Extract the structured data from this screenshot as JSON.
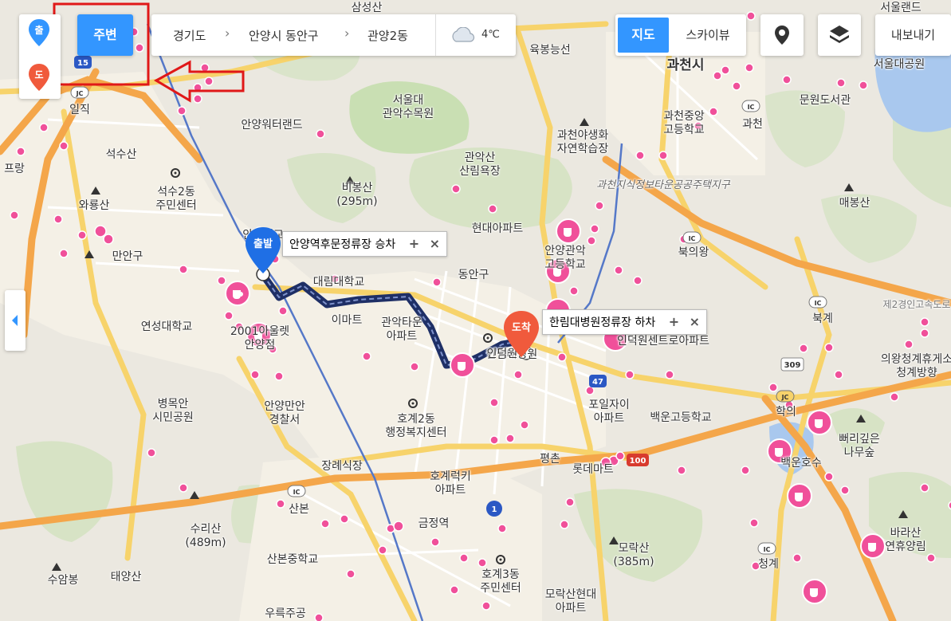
{
  "side_markers": {
    "start": "출",
    "end": "도"
  },
  "nearby_button": "주변",
  "breadcrumb": [
    "경기도",
    "안양시 동안구",
    "관양2동"
  ],
  "weather": "4℃",
  "map_type": {
    "map": "지도",
    "sky": "스카이뷰"
  },
  "export_button": "내보내기",
  "route": {
    "start_badge": "출발",
    "start_label": "안양역후문정류장 승차",
    "end_badge": "도착",
    "end_label": "한림대병원정류장 하차"
  },
  "road_badges": {
    "r15": "15",
    "r47": "47",
    "r100": "100",
    "r309": "309",
    "r1": "1",
    "jc": "JC",
    "ic": "IC"
  },
  "place_labels": [
    {
      "t": "삼성산"
    },
    {
      "t": "육봉능선"
    },
    {
      "t": "서울랜드"
    },
    {
      "t": "과천시"
    },
    {
      "t": "서울대공원"
    },
    {
      "t": "일직"
    },
    {
      "t": "서울대\n관악수목원"
    },
    {
      "t": "안양워터랜드"
    },
    {
      "t": "과천중앙\n고등학교"
    },
    {
      "t": "과천"
    },
    {
      "t": "문원도서관"
    },
    {
      "t": "과천야생화\n자연학습장"
    },
    {
      "t": "석수산"
    },
    {
      "t": "관악산\n산림욕장"
    },
    {
      "t": "과천지식정보타운공공주택지구"
    },
    {
      "t": "석수2동\n주민센터"
    },
    {
      "t": "비봉산\n(295m)"
    },
    {
      "t": "매봉산"
    },
    {
      "t": "와룡산"
    },
    {
      "t": "현대아파트"
    },
    {
      "t": "만안구"
    },
    {
      "t": "북의왕"
    },
    {
      "t": "안양대교"
    },
    {
      "t": "안양관악\n고등학교"
    },
    {
      "t": "대림대학교"
    },
    {
      "t": "동안구"
    },
    {
      "t": "제2경인고속도로"
    },
    {
      "t": "연성대학교"
    },
    {
      "t": "이마트"
    },
    {
      "t": "관악타운\n아파트"
    },
    {
      "t": "2001아울렛\n안양점"
    },
    {
      "t": "한림대병원"
    },
    {
      "t": "인덕원센트로아파트"
    },
    {
      "t": "북계"
    },
    {
      "t": "의왕청계휴게소\n청계방향"
    },
    {
      "t": "병목안\n시민공원"
    },
    {
      "t": "포일자이\n아파트"
    },
    {
      "t": "안양만안\n경찰서"
    },
    {
      "t": "호계2동\n행정복지센터"
    },
    {
      "t": "백운고등학교"
    },
    {
      "t": "학의"
    },
    {
      "t": "뻐리깊은\n나무숲"
    },
    {
      "t": "장례식장"
    },
    {
      "t": "평촌"
    },
    {
      "t": "롯데마트"
    },
    {
      "t": "백운호수"
    },
    {
      "t": "호계럭키\n아파트"
    },
    {
      "t": "산본"
    },
    {
      "t": "수리산\n(489m)"
    },
    {
      "t": "금정역"
    },
    {
      "t": "모락산\n(385m)"
    },
    {
      "t": "바라산\n연휴양림"
    },
    {
      "t": "산본중학교"
    },
    {
      "t": "청계"
    },
    {
      "t": "수암봉"
    },
    {
      "t": "태양산"
    },
    {
      "t": "호계3동\n주민센터"
    },
    {
      "t": "모락산현대\n아파트"
    },
    {
      "t": "우륵주공"
    },
    {
      "t": "안양역"
    },
    {
      "t": "인덕원"
    },
    {
      "t": "프랑"
    }
  ],
  "colors": {
    "accent": "#3396ff",
    "poi": "#f0509a",
    "route": "#2c3e7a",
    "highlight": "#e01818",
    "end_marker": "#f05a3c"
  }
}
